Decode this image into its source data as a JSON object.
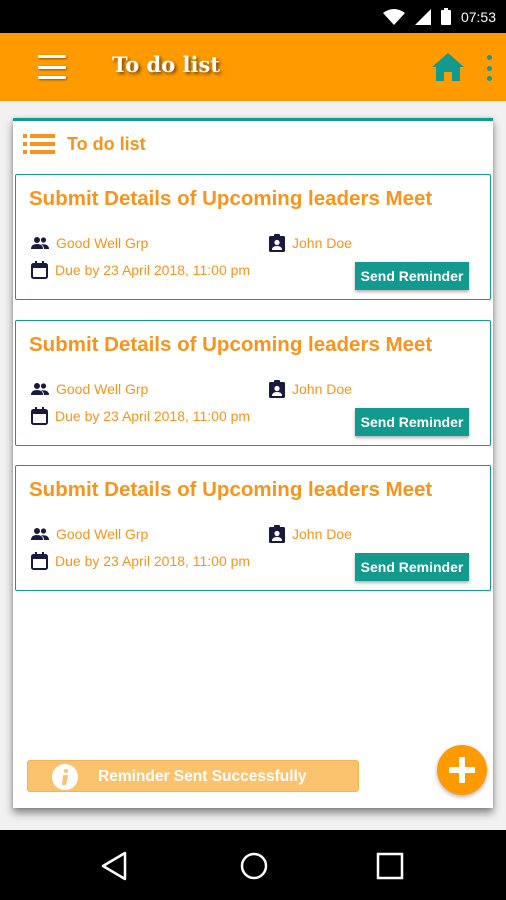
{
  "status_bar": {
    "time": "07:53",
    "icons": [
      "wifi-icon",
      "signal-icon",
      "battery-icon"
    ]
  },
  "app_bar": {
    "title": "To do list",
    "icons": [
      "menu-icon",
      "home-icon",
      "more-vert-icon"
    ],
    "color": "#ff9a00"
  },
  "section": {
    "title": "To do list",
    "icon": "list-icon"
  },
  "tasks": [
    {
      "title": "Submit Details of Upcoming leaders Meet",
      "group": "Good Well Grp",
      "assignee": "John Doe",
      "due": "Due by 23 April 2018, 11:00 pm",
      "button": "Send Reminder"
    },
    {
      "title": "Submit Details of Upcoming leaders Meet",
      "group": "Good Well Grp",
      "assignee": "John Doe",
      "due": "Due by 23 April 2018, 11:00 pm",
      "button": "Send Reminder"
    },
    {
      "title": "Submit Details of Upcoming leaders Meet",
      "group": "Good Well Grp",
      "assignee": "John Doe",
      "due": "Due by 23 April 2018, 11:00 pm",
      "button": "Send Reminder"
    }
  ],
  "toast": {
    "text": "Reminder Sent Successfully",
    "icon": "info-icon"
  },
  "fab": {
    "icon": "plus-icon"
  },
  "nav_bar": {
    "icons": [
      "back-icon",
      "home-circle-icon",
      "recents-icon"
    ]
  },
  "colors": {
    "accent": "#ff9a00",
    "text_orange": "#f7941d",
    "teal": "#129a8f",
    "icon_dark": "#1a1a3d"
  }
}
